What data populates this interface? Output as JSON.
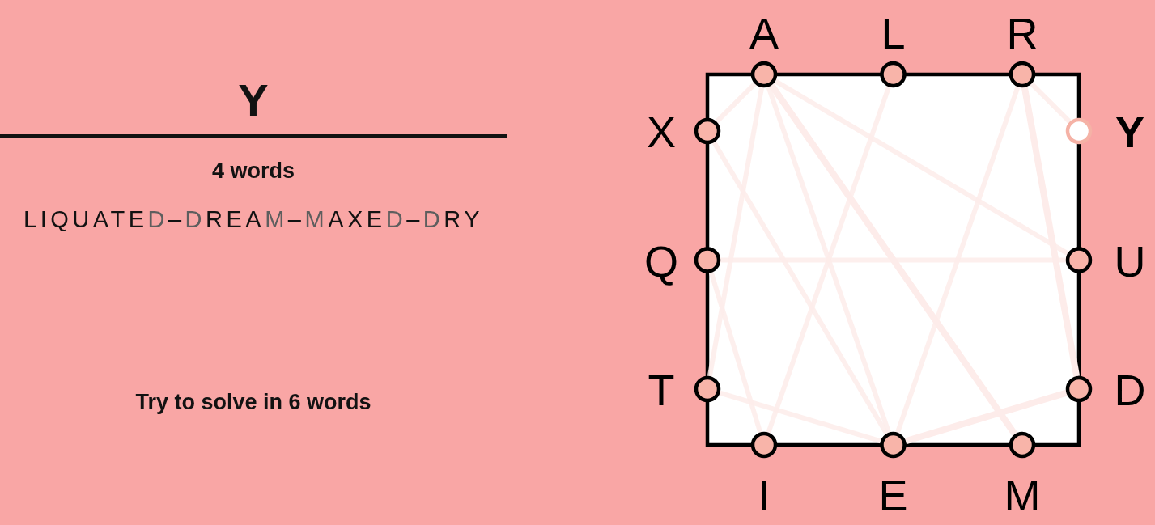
{
  "current_word": "Y",
  "word_count": "4 words",
  "trail": {
    "words": [
      "LIQUATED",
      "DREAM",
      "MAXED",
      "DRY"
    ],
    "separator": "–"
  },
  "goal": "Try to solve in 6 words",
  "board": {
    "sides": [
      {
        "kind": "top",
        "letters": [
          {
            "letter": "A",
            "selected": false
          },
          {
            "letter": "L",
            "selected": false
          },
          {
            "letter": "R",
            "selected": false
          }
        ]
      },
      {
        "kind": "right",
        "letters": [
          {
            "letter": "Y",
            "selected": true
          },
          {
            "letter": "U",
            "selected": false
          },
          {
            "letter": "D",
            "selected": false
          }
        ]
      },
      {
        "kind": "bottom",
        "letters": [
          {
            "letter": "I",
            "selected": false
          },
          {
            "letter": "E",
            "selected": false
          },
          {
            "letter": "M",
            "selected": false
          }
        ]
      },
      {
        "kind": "left",
        "letters": [
          {
            "letter": "X",
            "selected": false
          },
          {
            "letter": "Q",
            "selected": false
          },
          {
            "letter": "T",
            "selected": false
          }
        ]
      }
    ]
  }
}
